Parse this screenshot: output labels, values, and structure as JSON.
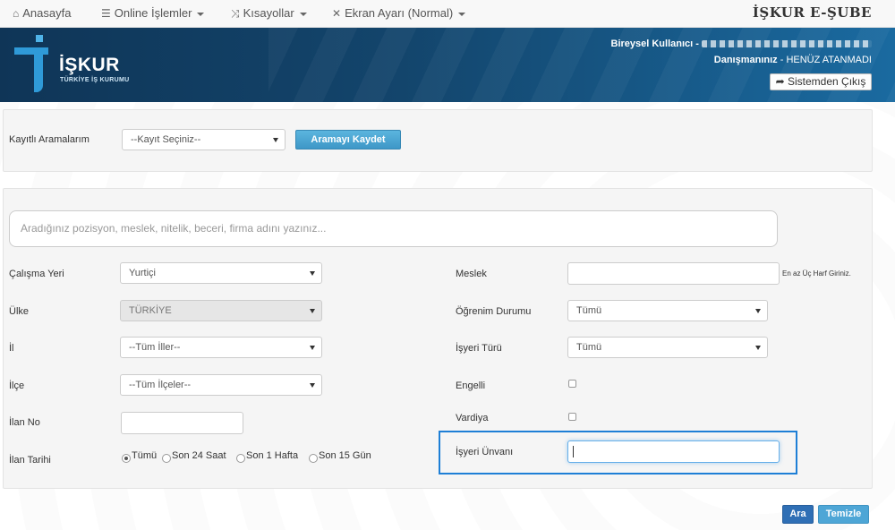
{
  "nav": {
    "home_label": "Anasayfa",
    "online_label": "Online İşlemler",
    "shortcuts_label": "Kısayollar",
    "screen_label": "Ekran Ayarı (Normal)",
    "brand": "İŞKUR E-ŞUBE"
  },
  "header": {
    "logo_text": "İŞKUR",
    "logo_sub": "TÜRKİYE İŞ KURUMU",
    "user_label": "Bireysel Kullanıcı -",
    "advisor_label": "Danışmanınız",
    "advisor_value": " - HENÜZ ATANMADI",
    "logout_label": "Sistemden Çıkış"
  },
  "saved": {
    "label": "Kayıtlı Aramalarım",
    "select_value": "--Kayıt Seçiniz--",
    "save_button": "Aramayı Kaydet"
  },
  "search": {
    "placeholder": "Aradığınız pozisyon, meslek, nitelik, beceri, firma adını yazınız..."
  },
  "form": {
    "workplace_label": "Çalışma Yeri",
    "workplace_value": "Yurtiçi",
    "country_label": "Ülke",
    "country_value": "TÜRKİYE",
    "province_label": "İl",
    "province_value": "--Tüm İller--",
    "district_label": "İlçe",
    "district_value": "--Tüm İlçeler--",
    "listing_no_label": "İlan No",
    "listing_date_label": "İlan Tarihi",
    "date_options": [
      "Tümü",
      "Son 24 Saat",
      "Son 1 Hafta",
      "Son 15 Gün"
    ],
    "profession_label": "Meslek",
    "profession_hint": "En az Üç Harf Giriniz.",
    "education_label": "Öğrenim Durumu",
    "education_value": "Tümü",
    "employer_type_label": "İşyeri Türü",
    "employer_type_value": "Tümü",
    "disabled_label": "Engelli",
    "shift_label": "Vardiya",
    "employer_title_label": "İşyeri Ünvanı"
  },
  "actions": {
    "search_button": "Ara",
    "clear_button": "Temizle"
  },
  "colors": {
    "header_bg": "#13456c",
    "primary_button": "#3e97c7",
    "focus_frame": "#1e7fd6"
  }
}
